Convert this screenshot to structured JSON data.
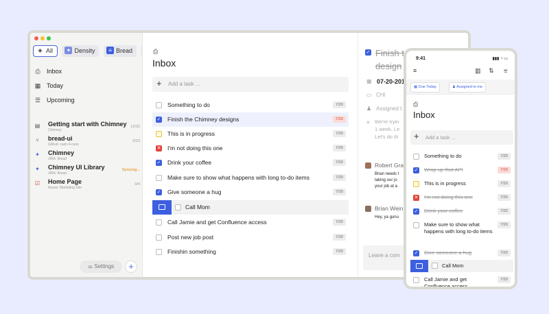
{
  "colors": {
    "accent": "#3d5fe0",
    "background": "#e9ecff",
    "done": "#3d5fe0",
    "cancelled": "#e0463a",
    "in_progress": "#e9c23a",
    "overdue": "#d0453a"
  },
  "sidebar": {
    "chips": [
      {
        "label": "All",
        "icon": "layers-icon",
        "active": true
      },
      {
        "label": "Density",
        "icon": "density-icon"
      },
      {
        "label": "Bread",
        "icon": "bread-icon"
      },
      {
        "label": "Br",
        "icon": "bread-icon"
      }
    ],
    "nav": [
      {
        "label": "Inbox",
        "icon": "inbox-icon"
      },
      {
        "label": "Today",
        "icon": "calendar-icon"
      },
      {
        "label": "Upcoming",
        "icon": "upcoming-icon"
      }
    ],
    "projects": [
      {
        "title": "Getting start with Chimney",
        "sub": "Chimney",
        "count": "12/32",
        "icon": "list-icon"
      },
      {
        "title": "bread-ui",
        "sub": "Github: cash-4-cans",
        "count": "0/23",
        "icon": "github-icon"
      },
      {
        "title": "Chimney",
        "sub": "JIRA: Bread",
        "count": "",
        "icon": "jira-icon"
      },
      {
        "title": "Chimney UI Library",
        "sub": "JIRA: Bread",
        "count": "Syncing...",
        "icon": "jira-icon"
      },
      {
        "title": "Home Page",
        "sub": "Asana: Marketing Site",
        "count": "0/4",
        "icon": "asana-icon"
      }
    ],
    "settings_label": "Settings",
    "add_label": "+"
  },
  "main": {
    "title": "Inbox",
    "add_placeholder": "Add a task ...",
    "tasks": [
      {
        "text": "Something to do",
        "date": "7/20",
        "state": "open"
      },
      {
        "text": "Finish the Chimney designs",
        "date": "7/20",
        "state": "done",
        "overdue": true,
        "selected": true
      },
      {
        "text": "This is in progress",
        "date": "7/20",
        "state": "progress"
      },
      {
        "text": "I'm not doing this one",
        "date": "7/20",
        "state": "cancelled"
      },
      {
        "text": "Drink your coffee",
        "date": "7/20",
        "state": "done"
      },
      {
        "text": "Make sure to show what happens with long to-do items",
        "date": "7/20",
        "state": "open"
      },
      {
        "text": "Give someone a hug",
        "date": "7/20",
        "state": "done"
      },
      {
        "text": "Call Mom",
        "date": "",
        "state": "open",
        "dragging": true
      },
      {
        "text": "Call Jamie and get Confluence access",
        "date": "7/20",
        "state": "open"
      },
      {
        "text": "Post new job post",
        "date": "7/20",
        "state": "open"
      },
      {
        "text": "Finishin something",
        "date": "7/20",
        "state": "open"
      }
    ]
  },
  "detail": {
    "title_line1": "Finish t",
    "title_line2": "design",
    "date": "07-20-201",
    "project": "CHI",
    "assigned": "Assigned t",
    "description": [
      "We're tryin",
      "1 week. Le",
      "Let's do th"
    ],
    "comments": [
      {
        "name": "Robert Gra",
        "lines": [
          "Brian needs t",
          "taking our jo",
          "your job at a"
        ]
      },
      {
        "name": "Brian Wein",
        "lines": [
          "Hey, ya gunu"
        ]
      }
    ],
    "comment_placeholder": "Leave a com"
  },
  "phone": {
    "time": "9:41",
    "status": "▮▮▮ ◔ ▭",
    "chips": [
      {
        "label": "Due Today",
        "icon": "calendar-icon"
      },
      {
        "label": "Assigned to me",
        "icon": "user-icon"
      }
    ],
    "title": "Inbox",
    "add_placeholder": "Add a task ...",
    "tasks": [
      {
        "text": "Something to do",
        "date": "7/20",
        "state": "open"
      },
      {
        "text": "Wrap up that API",
        "date": "7/20",
        "state": "done",
        "overdue": true
      },
      {
        "text": "This is in progress",
        "date": "7/20",
        "state": "progress"
      },
      {
        "text": "I'm not doing this one",
        "date": "7/20",
        "state": "cancelled"
      },
      {
        "text": "Drink your coffee",
        "date": "7/20",
        "state": "done"
      },
      {
        "text": "Make sure to show what happens with long to-do items",
        "date": "7/20",
        "state": "open"
      },
      {
        "text": "Give someone a hug",
        "date": "7/20",
        "state": "done"
      },
      {
        "text": "Call Mom",
        "date": "",
        "state": "open",
        "dragging": true
      },
      {
        "text": "Call Jamie and get Confluence access",
        "date": "7/20",
        "state": "open"
      }
    ]
  }
}
